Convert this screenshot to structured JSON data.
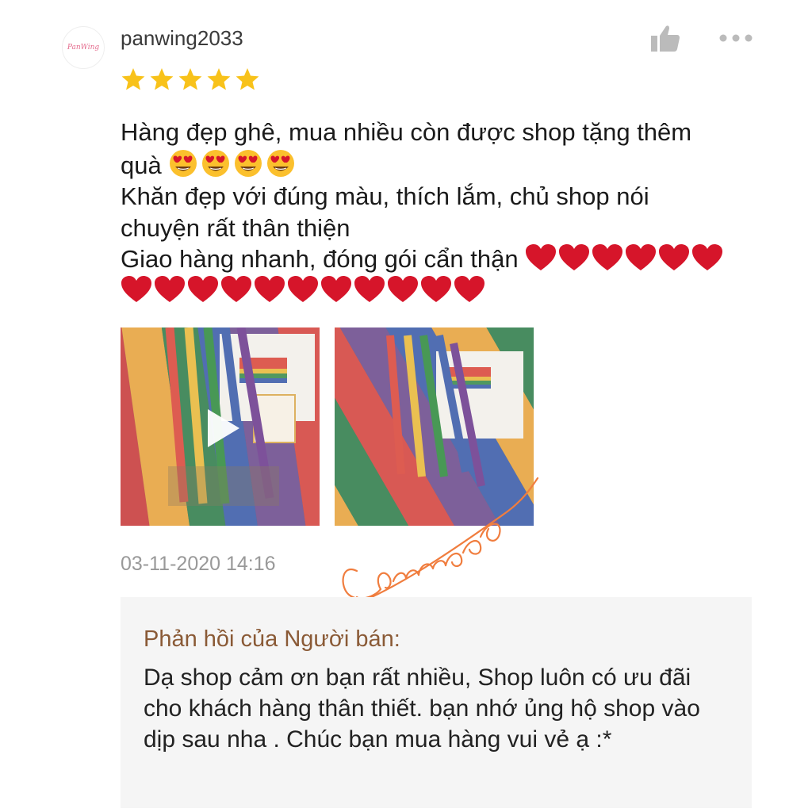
{
  "review": {
    "username": "panwing2033",
    "avatar_text": "PanWing",
    "rating": 5,
    "lines": [
      "Hàng đẹp ghê, mua nhiều còn được shop tặng thêm",
      "quà",
      "Khăn đẹp với đúng màu, thích lắm, chủ shop nói",
      "chuyện rất thân thiện",
      "Giao hàng nhanh, đóng gói cẩn thận"
    ],
    "emoji_smiling_heart_eyes_count": 4,
    "hearts_line5_count": 6,
    "hearts_line6_count": 11,
    "media": [
      {
        "type": "video",
        "icon": "play-icon"
      },
      {
        "type": "photo"
      }
    ],
    "timestamp": "03-11-2020 14:16",
    "watermark": "Caivang68"
  },
  "seller_reply": {
    "title": "Phản hồi của Người bán:",
    "text": "Dạ shop cảm ơn bạn rất nhiều, Shop luôn có ưu đãi cho khách hàng thân thiết. bạn nhớ ủng hộ shop vào dịp sau nha . Chúc bạn mua hàng vui vẻ ạ :*"
  },
  "icons": [
    "thumbs-up-icon",
    "more-icon",
    "star-icon",
    "heart-icon",
    "heart-eyes-emoji",
    "play-icon"
  ],
  "colors": {
    "star": "#f8c21a",
    "heart": "#d6152a",
    "reply_title": "#8a5a36",
    "reply_bg": "#f5f5f5",
    "timestamp": "#999999",
    "icon_grey": "#bbbbbb",
    "signature": "#f07d3e"
  }
}
